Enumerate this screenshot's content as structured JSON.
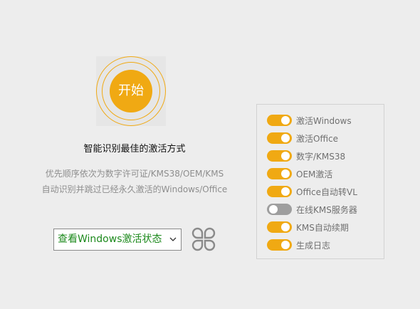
{
  "start": {
    "label": "开始"
  },
  "headline": "智能识别最佳的激活方式",
  "description": [
    "优先顺序依次为数字许可证/KMS38/OEM/KMS",
    "自动识别并跳过已经永久激活的Windows/Office"
  ],
  "status_select": {
    "selected": "查看Windows激活状态",
    "icon": "chevron-down-icon"
  },
  "clover_icon": "clover-icon",
  "options": [
    {
      "label": "激活Windows",
      "enabled": true
    },
    {
      "label": "激活Office",
      "enabled": true
    },
    {
      "label": "数字/KMS38",
      "enabled": true
    },
    {
      "label": "OEM激活",
      "enabled": true
    },
    {
      "label": "Office自动转VL",
      "enabled": true
    },
    {
      "label": "在线KMS服务器",
      "enabled": false
    },
    {
      "label": "KMS自动续期",
      "enabled": true
    },
    {
      "label": "生成日志",
      "enabled": true
    }
  ],
  "colors": {
    "accent": "#f0a913",
    "toggle_off": "#9e9e9e",
    "select_text": "#1d8a1d",
    "background": "#ededed"
  }
}
